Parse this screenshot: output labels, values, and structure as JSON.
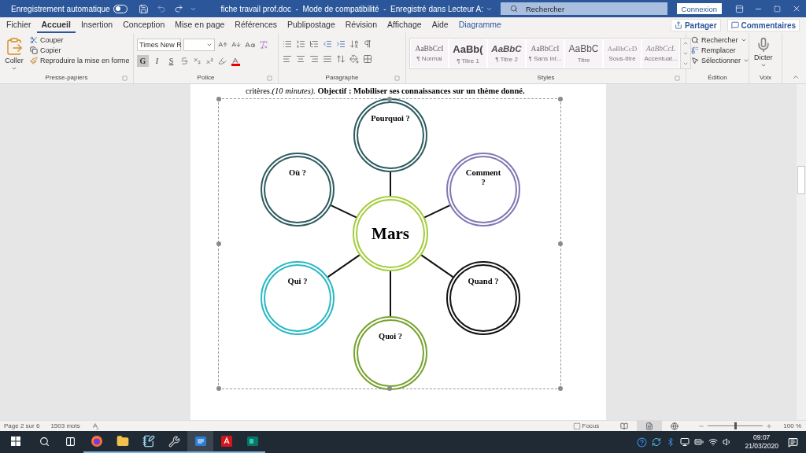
{
  "title_bar": {
    "autosave_label": "Enregistrement automatique",
    "autosave_on": false,
    "title": "fiche travail prof.doc  -  Mode de compatibilité  -  Enregistré dans Lecteur A:",
    "search_placeholder": "Rechercher",
    "signin": "Connexion"
  },
  "tabs": [
    {
      "label": "Fichier",
      "selected": false,
      "contextual": false
    },
    {
      "label": "Accueil",
      "selected": true,
      "contextual": false
    },
    {
      "label": "Insertion",
      "selected": false,
      "contextual": false
    },
    {
      "label": "Conception",
      "selected": false,
      "contextual": false
    },
    {
      "label": "Mise en page",
      "selected": false,
      "contextual": false
    },
    {
      "label": "Références",
      "selected": false,
      "contextual": false
    },
    {
      "label": "Publipostage",
      "selected": false,
      "contextual": false
    },
    {
      "label": "Révision",
      "selected": false,
      "contextual": false
    },
    {
      "label": "Affichage",
      "selected": false,
      "contextual": false
    },
    {
      "label": "Aide",
      "selected": false,
      "contextual": false
    },
    {
      "label": "Diagramme",
      "selected": false,
      "contextual": true
    }
  ],
  "tab_actions": {
    "share": "Partager",
    "comments": "Commentaires"
  },
  "ribbon": {
    "clipboard": {
      "paste": "Coller",
      "cut": "Couper",
      "copy": "Copier",
      "format_painter": "Reproduire la mise en forme",
      "label": "Presse-papiers"
    },
    "font": {
      "name": "Times New R",
      "format_buttons": [
        {
          "label": "G",
          "selected": true
        },
        {
          "label": "I",
          "selected": false
        },
        {
          "label": "S",
          "selected": false
        }
      ],
      "label": "Police"
    },
    "paragraph": {
      "label": "Paragraphe"
    },
    "styles": {
      "label": "Styles",
      "items": [
        {
          "preview": "AaBbCcI",
          "name": "¶ Normal",
          "kind": "normal"
        },
        {
          "preview": "AaBb(",
          "name": "¶ Titre 1",
          "kind": "heading1"
        },
        {
          "preview": "AaBbC",
          "name": "¶ Titre 2",
          "kind": "heading2"
        },
        {
          "preview": "AaBbCcI",
          "name": "¶ Sans int...",
          "kind": "nospacing"
        },
        {
          "preview": "AaBbC",
          "name": "Titre",
          "kind": "title"
        },
        {
          "preview": "AaBbCcD",
          "name": "Sous-titre",
          "kind": "subtitle"
        },
        {
          "preview": "AaBbCcL",
          "name": "Accentuat...",
          "kind": "emphasis"
        }
      ]
    },
    "editing": {
      "label": "Édition",
      "find": "Rechercher",
      "replace": "Remplacer",
      "select": "Sélectionner"
    },
    "voice": {
      "label": "Voix",
      "dictate": "Dicter"
    }
  },
  "document": {
    "text": "critères.*(10 minutes).* **Objectif : Mobiliser ses connaissances sur un thème donné.**",
    "diagram": {
      "center": "Mars",
      "nodes": [
        {
          "label_lines": [
            "Pourquoi ?"
          ],
          "color": "#2e5b60"
        },
        {
          "label_lines": [
            "Où ?"
          ],
          "color": "#2e5b60"
        },
        {
          "label_lines": [
            "Comment",
            "?"
          ],
          "color": "#8078b4"
        },
        {
          "label_lines": [
            "Qui ?"
          ],
          "color": "#2ab8c2"
        },
        {
          "label_lines": [
            "Quand ?"
          ],
          "color": "#111111"
        },
        {
          "label_lines": [
            "Quoi ?"
          ],
          "color": "#78a22f"
        }
      ]
    }
  },
  "status_bar": {
    "page": "Page 2 sur 6",
    "words": "1503 mots",
    "focus": "Focus",
    "views": [
      {
        "kind": "read",
        "selected": false
      },
      {
        "kind": "print",
        "selected": true
      },
      {
        "kind": "web",
        "selected": false
      }
    ],
    "zoom": {
      "level": 0.5
    },
    "zoom_text": "100 %"
  },
  "taskbar": {
    "apps": [
      {
        "kind": "firefox",
        "active": false
      },
      {
        "kind": "folder",
        "active": false
      },
      {
        "kind": "notepad",
        "active": false
      },
      {
        "kind": "tool",
        "active": false
      },
      {
        "kind": "word",
        "active": true
      },
      {
        "kind": "pdf",
        "active": false
      },
      {
        "kind": "publisher",
        "active": false
      }
    ],
    "time": "09:07",
    "date": "21/03/2020"
  }
}
